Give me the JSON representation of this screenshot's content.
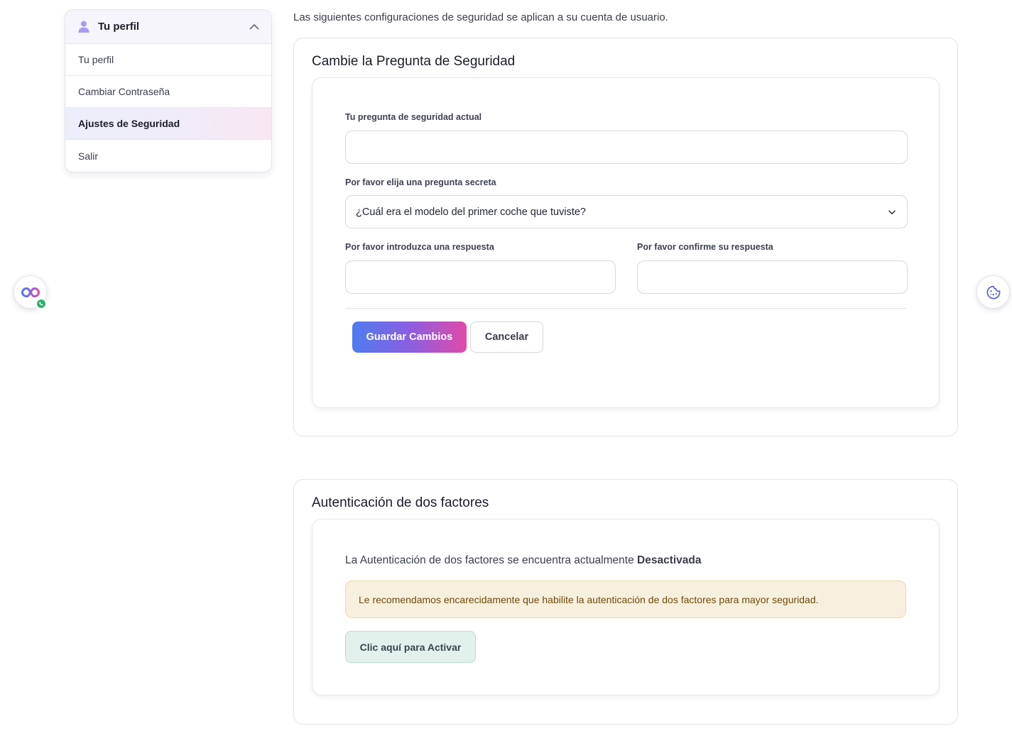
{
  "sidebar": {
    "header_label": "Tu perfil",
    "items": [
      {
        "label": "Tu perfil"
      },
      {
        "label": "Cambiar Contraseña"
      },
      {
        "label": "Ajustes de Seguridad",
        "active": true
      },
      {
        "label": "Salir"
      }
    ]
  },
  "intro_text": "Las siguientes configuraciones de seguridad se aplican a su cuenta de usuario.",
  "security_question": {
    "title": "Cambie la Pregunta de Seguridad",
    "current_label": "Tu pregunta de seguridad actual",
    "current_value": "",
    "select_label": "Por favor elija una pregunta secreta",
    "select_value": "¿Cuál era el modelo del primer coche que tuviste?",
    "answer_label": "Por favor introduzca una respuesta",
    "answer_value": "",
    "confirm_label": "Por favor confirme su respuesta",
    "confirm_value": "",
    "save_label": "Guardar Cambios",
    "cancel_label": "Cancelar"
  },
  "two_factor": {
    "title": "Autenticación de dos factores",
    "status_prefix": "La Autenticación de dos factores se encuentra actualmente",
    "status_value": "Desactivada",
    "alert_text": "Le recomendamos encarecidamente que habilite la autenticación de dos factores para mayor seguridad.",
    "activate_label": "Clic aquí para Activar"
  },
  "colors": {
    "accent_start": "#4f7cf0",
    "accent_end": "#e04aa8",
    "alert_bg": "#f8f0de",
    "activate_bg": "#e2f1ec",
    "whatsapp_badge": "#2ab36a"
  },
  "icons": {
    "sidebar_header": "user-icon",
    "sidebar_toggle": "chevron-up-icon",
    "select_toggle": "chevron-down-icon",
    "left_widget": "chat-loop-icon",
    "left_widget_badge": "whatsapp-icon",
    "right_widget": "cookie-icon"
  }
}
